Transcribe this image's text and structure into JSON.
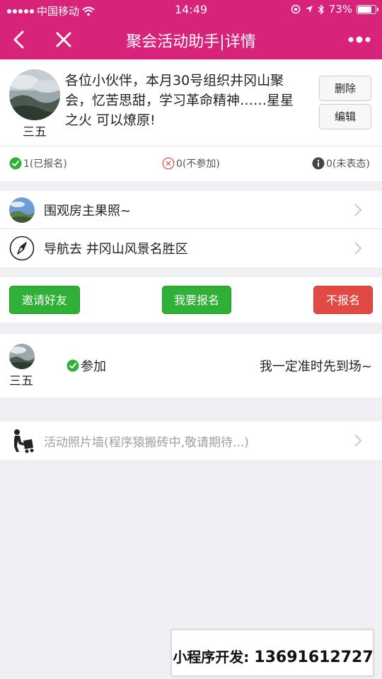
{
  "status_bar": {
    "carrier": "中国移动",
    "time": "14:49",
    "battery": "73%",
    "battery_level": 0.73
  },
  "nav": {
    "title": "聚会活动助手|详情",
    "back_icon": "back-arrow-icon",
    "close_icon": "close-icon",
    "more_icon": "more-dots-icon"
  },
  "activity": {
    "description": "各位小伙伴，本月30号组织井冈山聚会，忆苦思甜，学习革命精神……星星之火 可以燎原!",
    "owner_name": "三五",
    "delete_label": "删除",
    "edit_label": "编辑",
    "stats": {
      "joined": "1(已报名)",
      "declined": "0(不参加)",
      "undecided": "0(未表态)"
    }
  },
  "links": [
    {
      "label": "围观房主果照~",
      "icon": "landscape-thumbnail-icon"
    },
    {
      "label": "导航去 井冈山风景名胜区",
      "icon": "compass-icon"
    }
  ],
  "actions": {
    "invite": "邀请好友",
    "signup": "我要报名",
    "decline": "不报名"
  },
  "participants": [
    {
      "name": "三五",
      "status": "参加",
      "message": "我一定准时先到场~"
    }
  ],
  "photo_wall": {
    "label": "活动照片墙(程序猿搬砖中,敬请期待...)",
    "icon": "worker-icon"
  },
  "ad": {
    "prefix": "小程序开发:",
    "phone": "13691612727"
  },
  "colors": {
    "brand": "#d8237a",
    "green": "#2fb036",
    "red": "#e14a43"
  }
}
